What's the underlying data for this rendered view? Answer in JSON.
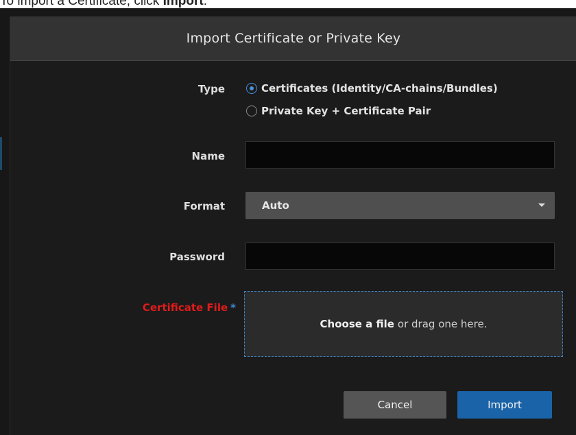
{
  "doc": {
    "prefix": "To import a Certificate, click ",
    "bold": "Import",
    "suffix": "."
  },
  "dialog": {
    "title": "Import Certificate or Private Key",
    "type": {
      "label": "Type",
      "options": [
        {
          "label": "Certificates (Identity/CA-chains/Bundles)",
          "selected": true
        },
        {
          "label": "Private Key + Certificate Pair",
          "selected": false
        }
      ]
    },
    "name": {
      "label": "Name",
      "value": ""
    },
    "format": {
      "label": "Format",
      "value": "Auto"
    },
    "password": {
      "label": "Password",
      "value": ""
    },
    "certificate_file": {
      "label": "Certificate File",
      "required_marker": "*",
      "choose_text": "Choose a file",
      "drag_text": "or drag one here."
    },
    "buttons": {
      "cancel": "Cancel",
      "import": "Import"
    }
  },
  "colors": {
    "accent": "#1a63a8",
    "required": "#e21b1b",
    "dropzone_border": "#3f7fbf"
  }
}
